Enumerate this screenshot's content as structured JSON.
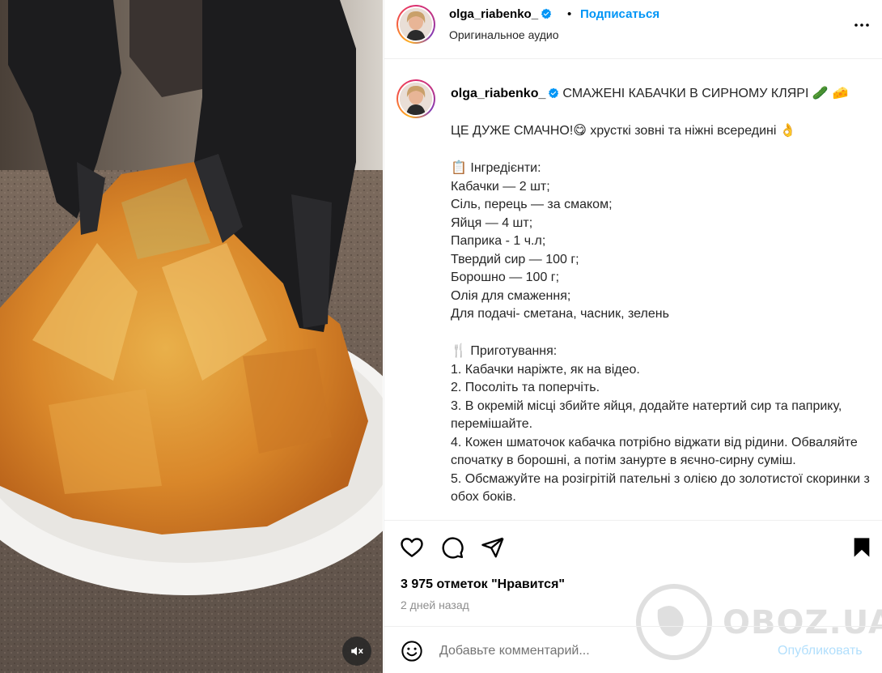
{
  "header": {
    "username": "olga_riabenko_",
    "dot": "•",
    "follow_label": "Подписаться",
    "audio_label": "Оригинальное аудио"
  },
  "caption": {
    "username": "olga_riabenko_",
    "lines": [
      "СМАЖЕНІ КАБАЧКИ В СИРНОМУ КЛЯРІ",
      "",
      "ЦЕ ДУЖЕ СМАЧНО! хрусткі зовні та ніжні всередині",
      "",
      "Інгредієнти:",
      "Кабачки — 2 шт;",
      "Сіль, перець — за смаком;",
      "Яйця — 4 шт;",
      "Паприка - 1 ч.л;",
      "Твердий сир — 100 г;",
      "Борошно — 100 г;",
      "Олія для смаження;",
      "Для подачі- сметана, часник, зелень",
      "",
      "Приготування:",
      "1. Кабачки наріжте, як на відео.",
      "2. Посоліть та поперчіть.",
      "3. В окремій місці збийте яйця, додайте натертий сир та паприку, перемішайте.",
      "4. Кожен шматочок кабачка потрібно віджати від рідини. Обваляйте спочатку в борошні, а потім занурте в яєчно-сирну суміш.",
      "5. Обсмажуйте на розігрітій пательні з олією до золотистої скоринки з обох боків."
    ],
    "title_text": "СМАЖЕНІ КАБАЧКИ В СИРНОМУ КЛЯРІ",
    "title_emojis": "🥒 🧀",
    "line2_text": "ЦЕ ДУЖЕ СМАЧНО!",
    "line2_emoji1": "😋",
    "line2_rest": "хрусткі зовні та ніжні всередині",
    "line2_emoji2": "👌",
    "ingredients_icon": "📋",
    "ingredients_title": "Інгредієнти:",
    "ingredients": [
      "Кабачки — 2 шт;",
      "Сіль, перець — за смаком;",
      "Яйця — 4 шт;",
      "Паприка - 1 ч.л;",
      "Твердий сир — 100 г;",
      "Борошно — 100 г;",
      "Олія для смаження;",
      "Для подачі- сметана, часник, зелень"
    ],
    "steps_icon": "🍴",
    "steps_title": "Приготування:",
    "steps": [
      "1. Кабачки наріжте, як на відео.",
      "2. Посоліть та поперчіть.",
      "3. В окремій місці збийте яйця, додайте натертий сир та паприку, перемішайте.",
      "4. Кожен шматочок кабачка потрібно віджати від рідини. Обваляйте спочатку в борошні, а потім занурте в яєчно-сирну суміш.",
      "5. Обсмажуйте на розігрітій пательні з олією до золотистої скоринки з обох боків."
    ]
  },
  "actions": {
    "icons": [
      "heart-icon",
      "comment-icon",
      "share-icon",
      "bookmark-icon"
    ],
    "likes_text": "3 975 отметок \"Нравится\"",
    "time_text": "2 дней назад"
  },
  "comment_box": {
    "placeholder": "Добавьте комментарий...",
    "publish_label": "Опубликовать"
  },
  "watermark": {
    "text": "OBOZ.UA"
  },
  "colors": {
    "accent_blue": "#0095f6",
    "publish_disabled": "#b2dffc",
    "verified": "#0095f6",
    "muted_text": "#8e8e8e"
  },
  "media": {
    "mute_icon": "speaker-muted-icon"
  }
}
